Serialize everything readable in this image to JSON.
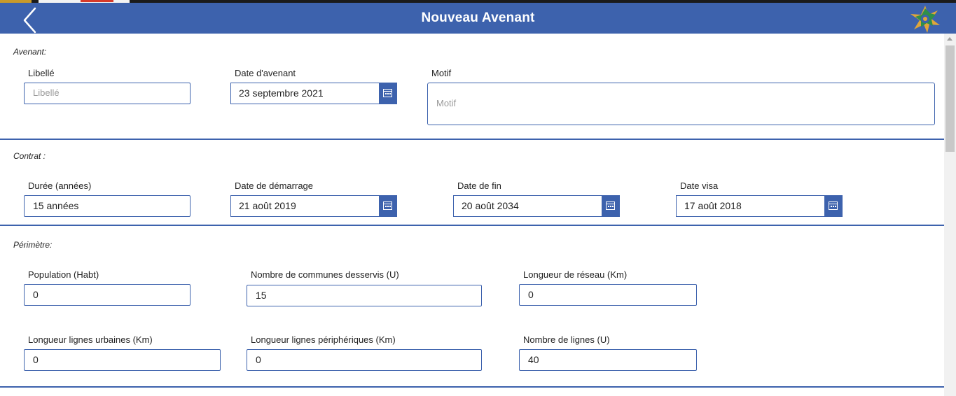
{
  "header": {
    "title": "Nouveau Avenant"
  },
  "colors": {
    "primary": "#3d62ad",
    "header_text": "#ffffff"
  },
  "icons": {
    "back": "chevron-left-icon",
    "logo": "emblem-logo",
    "date": "calendar-icon"
  },
  "avenant": {
    "title": "Avenant:",
    "libelle": {
      "label": "Libellé",
      "placeholder": "Libellé",
      "value": ""
    },
    "date_avenant": {
      "label": "Date d'avenant",
      "value": "23 septembre 2021"
    },
    "motif": {
      "label": "Motif",
      "placeholder": "Motif",
      "value": ""
    }
  },
  "contrat": {
    "title": "Contrat :",
    "duree": {
      "label": "Durée (années)",
      "value": "15 années"
    },
    "date_demarrage": {
      "label": "Date de démarrage",
      "value": "21 août 2019"
    },
    "date_fin": {
      "label": "Date de fin",
      "value": "20 août 2034"
    },
    "date_visa": {
      "label": "Date visa",
      "value": "17 août 2018"
    }
  },
  "perimetre": {
    "title": "Périmètre:",
    "population": {
      "label": "Population (Habt)",
      "value": "0"
    },
    "communes": {
      "label": "Nombre de communes desservis (U)",
      "value": "15"
    },
    "longueur_reseau": {
      "label": "Longueur de réseau (Km)",
      "value": "0"
    },
    "lignes_urbaines": {
      "label": "Longueur lignes urbaines (Km)",
      "value": "0"
    },
    "lignes_peripheriques": {
      "label": "Longueur lignes périphériques (Km)",
      "value": "0"
    },
    "nombre_lignes": {
      "label": "Nombre de lignes (U)",
      "value": "40"
    }
  }
}
